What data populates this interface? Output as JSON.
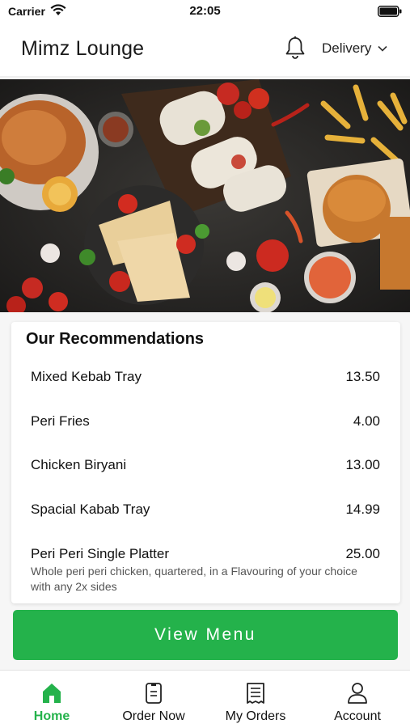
{
  "status_bar": {
    "carrier": "Carrier",
    "time": "22:05"
  },
  "header": {
    "title": "Mimz Lounge",
    "mode_selector": "Delivery"
  },
  "recommendations": {
    "heading": "Our Recommendations",
    "items": [
      {
        "name": "Mixed Kebab Tray",
        "price": "13.50",
        "description": ""
      },
      {
        "name": "Peri Fries",
        "price": "4.00",
        "description": ""
      },
      {
        "name": "Chicken Biryani",
        "price": "13.00",
        "description": ""
      },
      {
        "name": "Spacial Kabab Tray",
        "price": "14.99",
        "description": ""
      },
      {
        "name": "Peri Peri Single Platter",
        "price": "25.00",
        "description": "Whole peri peri chicken, quartered, in a Flavouring of your choice with any 2x sides"
      }
    ]
  },
  "view_menu_label": "View Menu",
  "tabs": [
    {
      "label": "Home",
      "icon": "home-icon",
      "active": true
    },
    {
      "label": "Order Now",
      "icon": "order-icon",
      "active": false
    },
    {
      "label": "My Orders",
      "icon": "receipt-icon",
      "active": false
    },
    {
      "label": "Account",
      "icon": "user-icon",
      "active": false
    }
  ],
  "colors": {
    "accent": "#24b24b",
    "hero_bg": "#232220"
  }
}
